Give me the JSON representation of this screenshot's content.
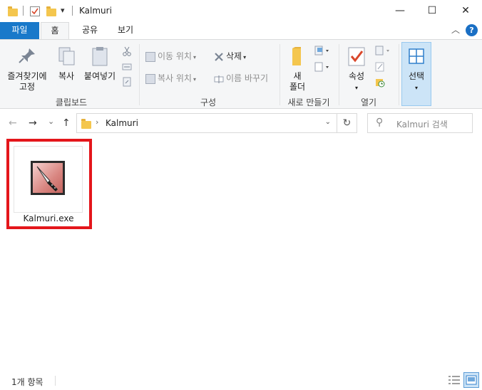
{
  "window": {
    "title": "Kalmuri",
    "minimize_glyph": "—",
    "maximize_glyph": "☐",
    "close_glyph": "✕"
  },
  "quick_access": {
    "dropdown_glyph": "▾"
  },
  "ribbon_tabs": [
    {
      "label": "파일"
    },
    {
      "label": "홈"
    },
    {
      "label": "공유"
    },
    {
      "label": "보기"
    }
  ],
  "ribbon": {
    "clipboard": {
      "pin_label_line1": "즐겨찾기에",
      "pin_label_line2": "고정",
      "copy_label": "복사",
      "paste_label": "붙여넣기",
      "group_label": "클립보드"
    },
    "organize": {
      "move_label": "이동 위치",
      "copy_to_label": "복사 위치",
      "delete_label": "삭제",
      "rename_label": "이름 바꾸기",
      "group_label": "구성"
    },
    "new": {
      "new_folder_line1": "새",
      "new_folder_line2": "폴더",
      "group_label": "새로 만들기"
    },
    "open": {
      "properties_label": "속성",
      "group_label": "열기"
    },
    "select": {
      "select_label": "선택"
    }
  },
  "navigation": {
    "back_glyph": "←",
    "forward_glyph": "→",
    "recent_glyph": "⌄",
    "up_glyph": "↑",
    "address_path": "Kalmuri",
    "address_chevron": "›",
    "address_dropdown": "⌄",
    "refresh_glyph": "↻",
    "search_placeholder": "Kalmuri 검색",
    "search_icon_glyph": "⚲"
  },
  "files": [
    {
      "name": "Kalmuri.exe",
      "icon": "knife-app-icon",
      "highlighted": true
    }
  ],
  "status_bar": {
    "item_count": "1개 항목"
  },
  "colors": {
    "file_tab": "#1979ca",
    "highlight_border": "#e4161b",
    "folder": "#f4c64e",
    "help": "#1a6fc4"
  }
}
